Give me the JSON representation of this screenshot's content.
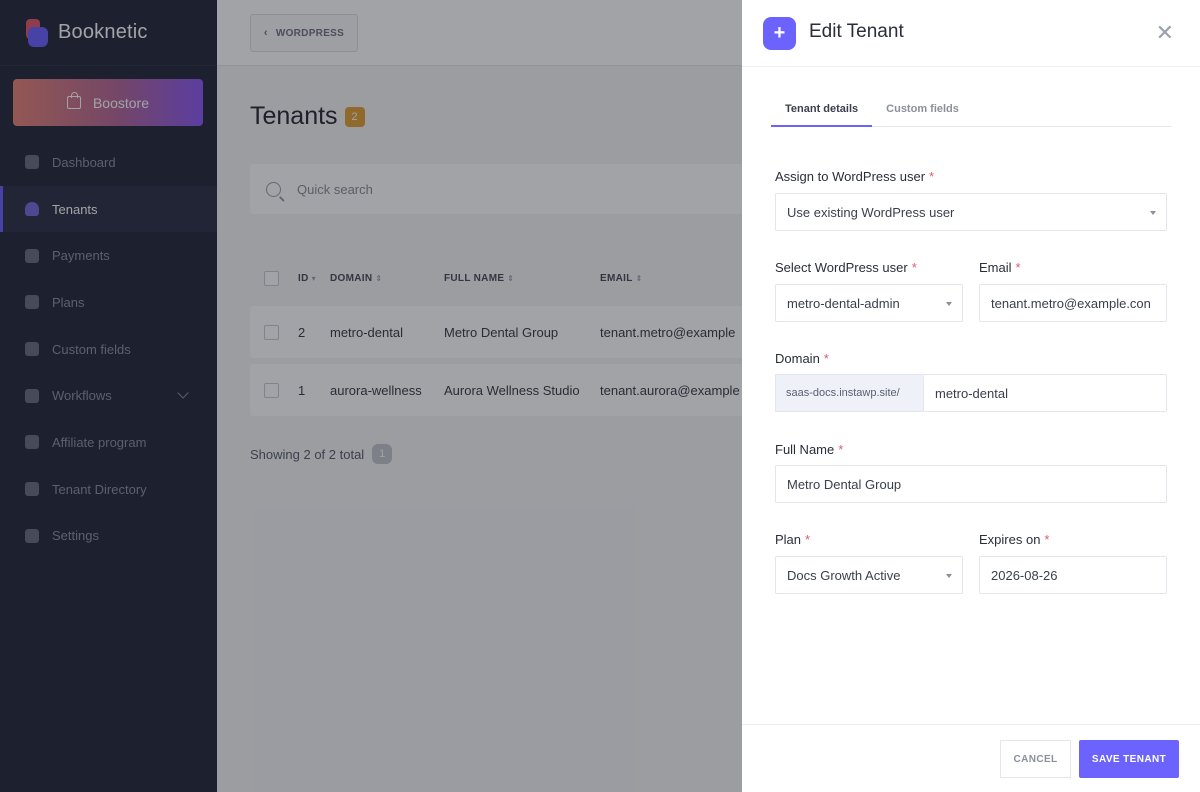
{
  "brand": {
    "name": "Booknetic"
  },
  "sidebar": {
    "boostore_label": "Boostore",
    "items": [
      {
        "label": "Dashboard",
        "icon": "dashboard-icon"
      },
      {
        "label": "Tenants",
        "icon": "user-icon"
      },
      {
        "label": "Payments",
        "icon": "credit-card-icon"
      },
      {
        "label": "Plans",
        "icon": "rocket-icon"
      },
      {
        "label": "Custom fields",
        "icon": "wand-icon"
      },
      {
        "label": "Workflows",
        "icon": "workflow-icon"
      },
      {
        "label": "Affiliate program",
        "icon": "target-icon"
      },
      {
        "label": "Tenant Directory",
        "icon": "laptop-icon"
      },
      {
        "label": "Settings",
        "icon": "gear-icon"
      }
    ]
  },
  "topbar": {
    "wordpress_label": "WORDPRESS"
  },
  "page": {
    "title": "Tenants",
    "count": "2"
  },
  "search": {
    "placeholder": "Quick search"
  },
  "table": {
    "headers": {
      "id": "ID",
      "domain": "DOMAIN",
      "full_name": "FULL NAME",
      "email": "EMAIL"
    },
    "rows": [
      {
        "id": "2",
        "domain": "metro-dental",
        "full_name": "Metro Dental Group",
        "email": "tenant.metro@example"
      },
      {
        "id": "1",
        "domain": "aurora-wellness",
        "full_name": "Aurora Wellness Studio",
        "email": "tenant.aurora@example"
      }
    ],
    "showing": "Showing 2 of 2 total",
    "page": "1"
  },
  "panel": {
    "title": "Edit Tenant",
    "tabs": [
      "Tenant details",
      "Custom fields"
    ],
    "assign_label": "Assign to WordPress user",
    "assign_value": "Use existing WordPress user",
    "select_user_label": "Select WordPress user",
    "select_user_value": "metro-dental-admin",
    "email_label": "Email",
    "email_value": "tenant.metro@example.con",
    "domain_label": "Domain",
    "domain_prefix": "saas-docs.instawp.site/",
    "domain_value": "metro-dental",
    "full_name_label": "Full Name",
    "full_name_value": "Metro Dental Group",
    "plan_label": "Plan",
    "plan_value": "Docs Growth Active",
    "expires_label": "Expires on",
    "expires_value": "2026-08-26",
    "required_mark": "*",
    "cancel_label": "CANCEL",
    "save_label": "SAVE TENANT"
  },
  "colors": {
    "accent": "#6c63ff",
    "sidebar": "#292d3f",
    "badge": "#e2a23b",
    "required": "#e05a6e"
  }
}
